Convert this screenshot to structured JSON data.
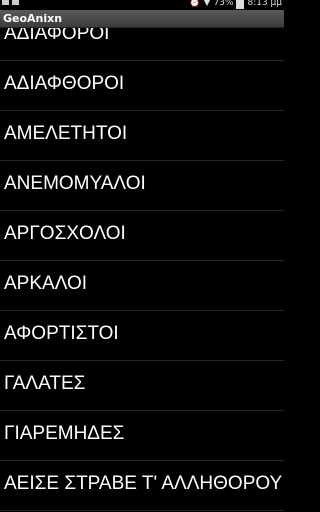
{
  "status_bar": {
    "battery": "73%",
    "time": "8:13 μμ"
  },
  "app": {
    "title": "GeoAnixn"
  },
  "list": {
    "items": [
      "ΑΔΙΑΦΟΡΟΙ",
      "ΑΔΙΑΦΘΟΡΟΙ",
      "ΑΜΕΛΕΤΗΤΟΙ",
      "ΑΝΕΜΟΜΥΑΛΟΙ",
      "ΑΡΓΟΣΧΟΛΟΙ",
      "ΑΡΚΑΛΟΙ",
      "ΑΦΟΡΤΙΣΤΟΙ",
      "ΓΑΛΑΤΕΣ",
      "ΓΙΑΡΕΜΗΔΕΣ",
      "ΑΕΙΣΕ ΣΤΡΑΒΕ Τ' ΑΛΛΗΘΟΡΟΥ"
    ]
  }
}
